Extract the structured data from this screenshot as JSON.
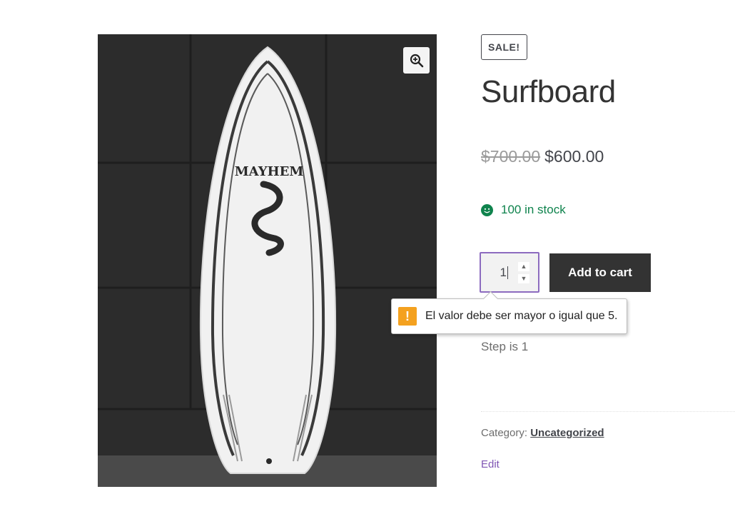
{
  "gallery": {
    "zoom_icon": "magnifier-plus-icon",
    "image_alt": "Surfboard product photo",
    "board_logo_text": "MAYHEM"
  },
  "product": {
    "sale_badge": "SALE!",
    "title": "Surfboard",
    "regular_price": "$700.00",
    "sale_price": "$600.00",
    "stock_icon": "smiley-icon",
    "stock_text": "100 in stock",
    "quantity_value": "1",
    "add_to_cart_label": "Add to cart",
    "step_text": "Step is 1",
    "category_label": "Category:",
    "category_value": "Uncategorized",
    "edit_label": "Edit"
  },
  "validation": {
    "icon": "warning-icon",
    "message": "El valor debe ser mayor o igual que 5."
  },
  "colors": {
    "stock_green": "#0f834d",
    "focus_purple": "#8c6bbf",
    "button_dark": "#333333",
    "warning_orange": "#f4a11f",
    "link_purple": "#7f54b3"
  }
}
